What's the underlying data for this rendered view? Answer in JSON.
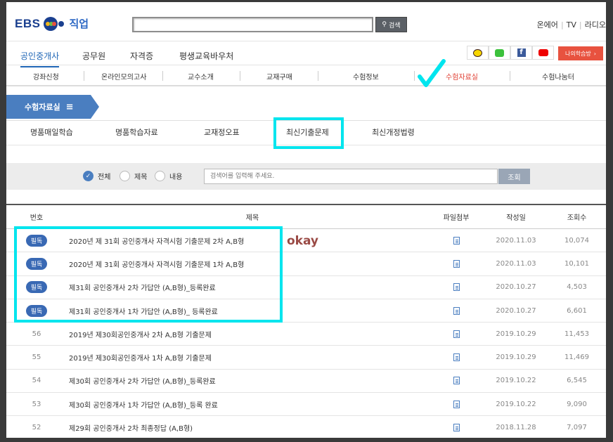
{
  "header": {
    "logo_text": "EBS",
    "logo_sub": "직업",
    "search_btn": "검색",
    "top_links": [
      "온에어",
      "TV",
      "라디오"
    ]
  },
  "gnb": {
    "items": [
      "공인중개사",
      "공무원",
      "자격증",
      "평생교육바우처"
    ],
    "active_index": 0,
    "my_learning": "나의학습방"
  },
  "submenu": {
    "items": [
      "강좌신청",
      "온라인모의고사",
      "교수소개",
      "교재구매",
      "수험정보",
      "수험자료실",
      "수험나눔터"
    ],
    "active_index": 5
  },
  "section": {
    "title": "수험자료실",
    "tabs": [
      "명품매일학습",
      "명품학습자료",
      "교재정오표",
      "최신기출문제",
      "최신개정법령"
    ],
    "active_tab_index": 3
  },
  "search": {
    "options": [
      "전체",
      "제목",
      "내용"
    ],
    "selected": "전체",
    "placeholder": "검색어를 입력해 주세요.",
    "button": "조회"
  },
  "table": {
    "headers": [
      "번호",
      "제목",
      "파일첨부",
      "작성일",
      "조회수"
    ],
    "rows": [
      {
        "no": "필독",
        "title": "2020년 제 31회 공인중개사 자격시험 기출문제 2차 A,B형",
        "date": "2020.11.03",
        "views": "10,074"
      },
      {
        "no": "필독",
        "title": "2020년 제 31회 공인중개사 자격시험 기출문제 1차 A,B형",
        "date": "2020.11.03",
        "views": "10,101"
      },
      {
        "no": "필독",
        "title": "제31회 공인중개사 2차 가답안 (A,B형)_등록완료",
        "date": "2020.10.27",
        "views": "4,503"
      },
      {
        "no": "필독",
        "title": "제31회 공인중개사 1차 가답안 (A,B형)_ 등록완료",
        "date": "2020.10.27",
        "views": "6,601"
      },
      {
        "no": "56",
        "title": "2019년 제30회공인중개사 2차 A,B형 기출문제",
        "date": "2019.10.29",
        "views": "11,453"
      },
      {
        "no": "55",
        "title": "2019년 제30회공인중개사 1차 A,B형 기출문제",
        "date": "2019.10.29",
        "views": "11,469"
      },
      {
        "no": "54",
        "title": "제30회 공인중개사 2차 가답안 (A,B형)_등록완료",
        "date": "2019.10.22",
        "views": "6,545"
      },
      {
        "no": "53",
        "title": "제30회 공인중개사 1차 가답안 (A,B형)_등록 완료",
        "date": "2019.10.22",
        "views": "9,090"
      },
      {
        "no": "52",
        "title": "제29회 공인중개사 2차 최종정답 (A,B형)",
        "date": "2018.11.28",
        "views": "7,097"
      }
    ]
  },
  "annotation": {
    "okay_text": "okay",
    "highlight_color": "#00e5ee",
    "check_color": "#00e5ee"
  },
  "colors": {
    "brand": "#1a3f8f",
    "accent": "#4a7ec0",
    "active_red": "#e04034",
    "badge": "#3969b4"
  }
}
